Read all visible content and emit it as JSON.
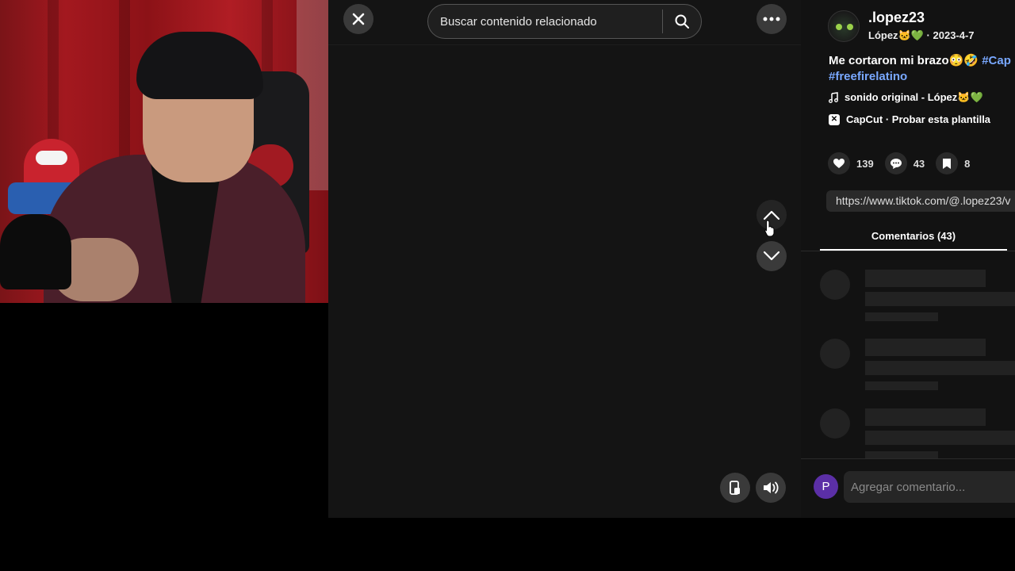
{
  "search": {
    "placeholder": "Buscar contenido relacionado"
  },
  "post": {
    "username": ".lopez23",
    "display_name": "López🐱💚",
    "date": "2023-4-7",
    "separator": " · ",
    "description": "Me cortaron mi brazo😳🤣 ",
    "hashtag_1": "#Cap",
    "hashtag_2": "#freefirelatino",
    "music": "sonido original - López🐱💚",
    "capcut": "CapCut · Probar esta plantilla",
    "likes": "139",
    "comments_count": "43",
    "saves": "8",
    "url": "https://www.tiktok.com/@.lopez23/v"
  },
  "comments_panel": {
    "tab_label": "Comentarios (43)",
    "input_placeholder": "Agregar comentario...",
    "user_initial": "P"
  },
  "icons": {
    "close": "close-icon",
    "more": "more-dots-icon",
    "search": "search-icon",
    "up": "chevron-up-icon",
    "down": "chevron-down-icon",
    "pip": "picture-in-picture-icon",
    "volume": "volume-icon",
    "heart": "heart-icon",
    "comment": "comment-icon",
    "bookmark": "bookmark-icon",
    "music": "music-note-icon",
    "capcut": "capcut-icon"
  },
  "colors": {
    "hashtag": "#79a8ff",
    "avatar_user": "#5b2fa6",
    "background": "#141414"
  }
}
